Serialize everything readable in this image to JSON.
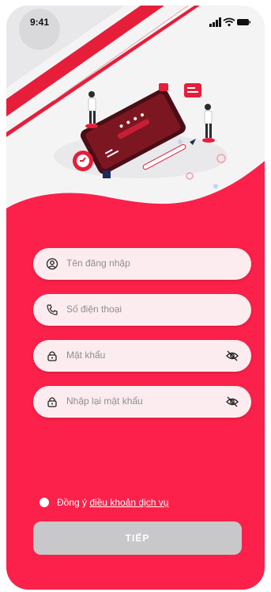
{
  "status_bar": {
    "time": "9:41"
  },
  "form": {
    "username_placeholder": "Tên đăng nhập",
    "phone_placeholder": "Số điện thoại",
    "password_placeholder": "Mật khẩu",
    "confirm_password_placeholder": "Nhập lại mật khẩu"
  },
  "terms": {
    "prefix": "Đồng ý ",
    "link": "điều khoản dịch vụ"
  },
  "submit": {
    "label": "TIẾP"
  },
  "colors": {
    "primary": "#fb214a",
    "field_bg": "#fdecef",
    "button_disabled": "#c8c8ca",
    "illustration_red": "#e61e3a"
  }
}
